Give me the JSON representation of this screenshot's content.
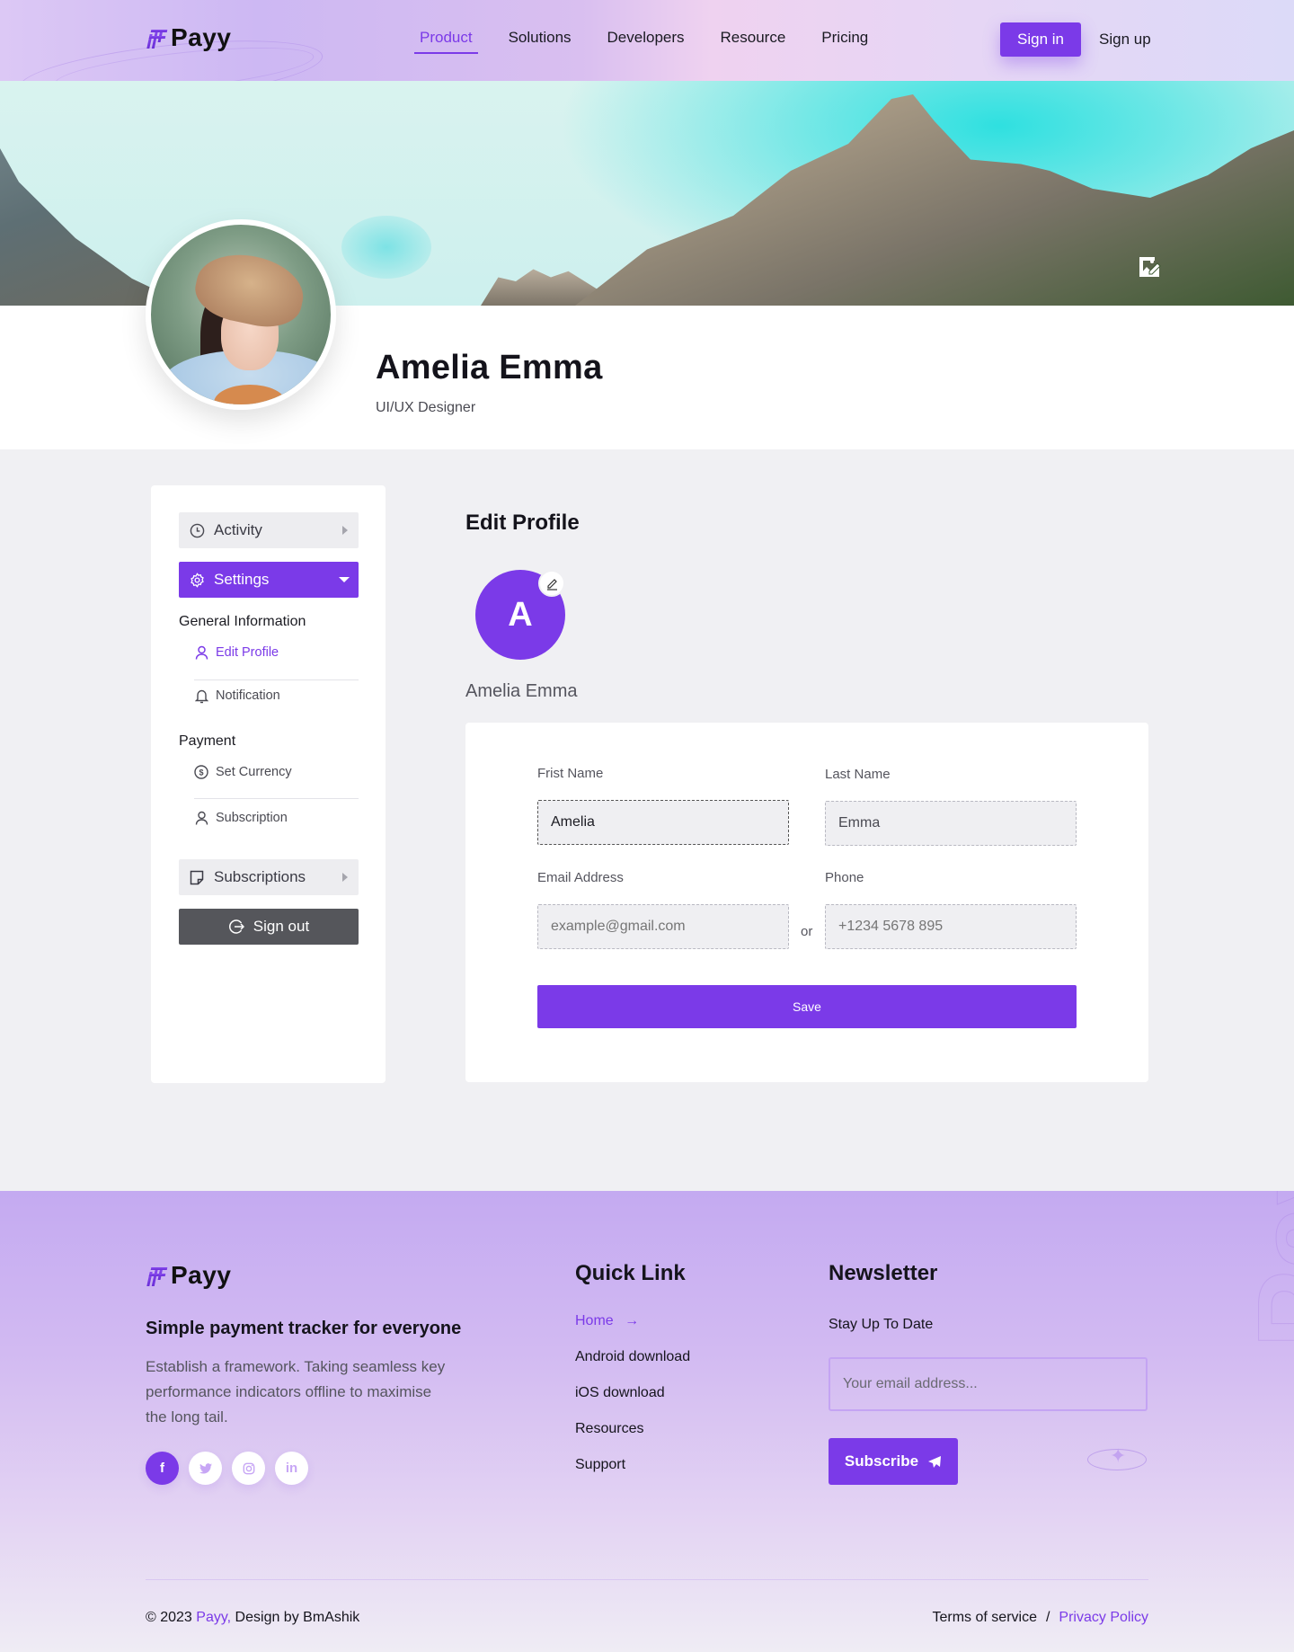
{
  "brand": {
    "name": "Payy"
  },
  "nav": {
    "items": [
      {
        "label": "Product",
        "active": true
      },
      {
        "label": "Solutions",
        "active": false
      },
      {
        "label": "Developers",
        "active": false
      },
      {
        "label": "Resource",
        "active": false
      },
      {
        "label": "Pricing",
        "active": false
      }
    ],
    "sign_in": "Sign in",
    "sign_up": "Sign up"
  },
  "profile": {
    "name": "Amelia Emma",
    "role": "UI/UX Designer",
    "banner_edit_icon": "image-edit-icon"
  },
  "sidebar": {
    "activity": "Activity",
    "settings": "Settings",
    "general_group": "General Information",
    "edit_profile": "Edit Profile",
    "notification": "Notification",
    "payment_group": "Payment",
    "set_currency": "Set Currency",
    "subscription": "Subscription",
    "subscriptions": "Subscriptions",
    "sign_out": "Sign out"
  },
  "edit_profile": {
    "title": "Edit Profile",
    "avatar_initial": "A",
    "display_name": "Amelia Emma",
    "form": {
      "first_name_label": "Frist Name",
      "first_name_value": "Amelia",
      "last_name_label": "Last Name",
      "last_name_value": "Emma",
      "email_label": "Email Address",
      "email_placeholder": "example@gmail.com",
      "or_label": "or",
      "phone_label": "Phone",
      "phone_placeholder": "+1234 5678 895",
      "save_label": "Save"
    }
  },
  "footer": {
    "tagline": "Simple payment tracker for everyone",
    "description": "Establish a framework. Taking seamless key performance indicators offline to maximise the long tail.",
    "socials": [
      {
        "icon": "facebook-icon",
        "glyph": "f"
      },
      {
        "icon": "twitter-icon",
        "glyph": "🐦"
      },
      {
        "icon": "instagram-icon",
        "glyph": "◎"
      },
      {
        "icon": "linkedin-icon",
        "glyph": "in"
      }
    ],
    "quick_link_title": "Quick Link",
    "quick_links": [
      {
        "label": "Home",
        "active": true
      },
      {
        "label": "Android download",
        "active": false
      },
      {
        "label": "iOS download",
        "active": false
      },
      {
        "label": "Resources",
        "active": false
      },
      {
        "label": "Support",
        "active": false
      }
    ],
    "home_arrow": "→",
    "newsletter_title": "Newsletter",
    "newsletter_subtitle": "Stay Up To Date",
    "newsletter_placeholder": "Your email address...",
    "subscribe_label": "Subscribe",
    "watermark": "Payy",
    "copyright_prefix": "© 2023 ",
    "copyright_brand": "Payy,",
    "copyright_suffix": " Design by BmAshik",
    "terms": "Terms of service",
    "separator": "/",
    "privacy": "Privacy Policy"
  },
  "colors": {
    "accent": "#7b3ae8",
    "page_bg": "#f0f0f3",
    "signout_bg": "#55565b"
  }
}
